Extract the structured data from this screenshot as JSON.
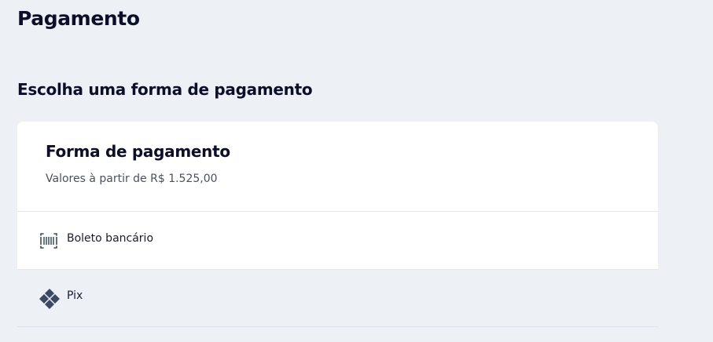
{
  "header": {
    "title": "Pagamento"
  },
  "section": {
    "title": "Escolha uma forma de pagamento"
  },
  "card": {
    "title": "Forma de pagamento",
    "subtitle": "Valores à partir de R$ 1.525,00"
  },
  "options": [
    {
      "label": "Boleto bancário",
      "icon": "barcode-icon"
    },
    {
      "label": "Pix",
      "icon": "pix-icon"
    }
  ],
  "colors": {
    "background": "#edf1f6",
    "card": "#ffffff",
    "text": "#0d0f2a",
    "muted": "#4a5060",
    "icon": "#3a4a63"
  }
}
